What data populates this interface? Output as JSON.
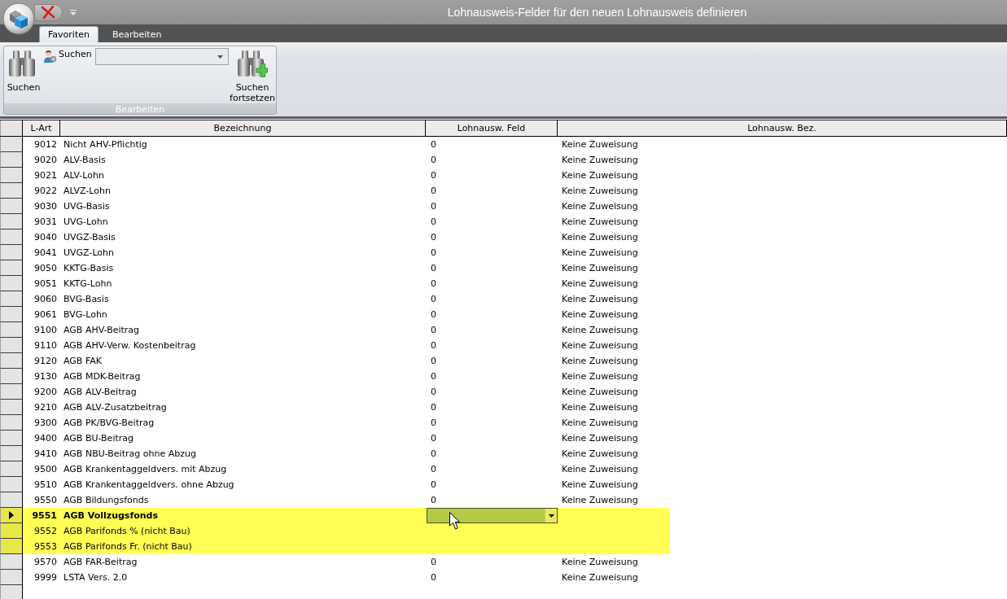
{
  "window": {
    "title": "Lohnausweis-Felder für den neuen Lohnausweis definieren"
  },
  "ribbon": {
    "tabs": [
      {
        "label": "Favoriten",
        "selected": true
      },
      {
        "label": "Bearbeiten",
        "selected": false
      }
    ],
    "groups": [
      {
        "label": "Bearbeiten",
        "items": [
          {
            "kind": "find",
            "label": "Suchen"
          },
          {
            "kind": "combo",
            "label": "Suchen"
          },
          {
            "kind": "find_next",
            "label": "Suchen fortsetzen"
          }
        ]
      }
    ]
  },
  "table": {
    "columns": [
      {
        "label": "L-Art"
      },
      {
        "label": "Bezeichnung"
      },
      {
        "label": "Lohnausw. Feld"
      },
      {
        "label": "Lohnausw. Bez."
      }
    ],
    "rows": [
      {
        "l_art": "9012",
        "bezeichnung": "Nicht AHV-Pflichtig",
        "lohnausw_feld": "0",
        "lohnausw_bez": "Keine Zuweisung",
        "selected": false,
        "current": false
      },
      {
        "l_art": "9020",
        "bezeichnung": "ALV-Basis",
        "lohnausw_feld": "0",
        "lohnausw_bez": "Keine Zuweisung",
        "selected": false,
        "current": false
      },
      {
        "l_art": "9021",
        "bezeichnung": "ALV-Lohn",
        "lohnausw_feld": "0",
        "lohnausw_bez": "Keine Zuweisung",
        "selected": false,
        "current": false
      },
      {
        "l_art": "9022",
        "bezeichnung": "ALVZ-Lohn",
        "lohnausw_feld": "0",
        "lohnausw_bez": "Keine Zuweisung",
        "selected": false,
        "current": false
      },
      {
        "l_art": "9030",
        "bezeichnung": "UVG-Basis",
        "lohnausw_feld": "0",
        "lohnausw_bez": "Keine Zuweisung",
        "selected": false,
        "current": false
      },
      {
        "l_art": "9031",
        "bezeichnung": "UVG-Lohn",
        "lohnausw_feld": "0",
        "lohnausw_bez": "Keine Zuweisung",
        "selected": false,
        "current": false
      },
      {
        "l_art": "9040",
        "bezeichnung": "UVGZ-Basis",
        "lohnausw_feld": "0",
        "lohnausw_bez": "Keine Zuweisung",
        "selected": false,
        "current": false
      },
      {
        "l_art": "9041",
        "bezeichnung": "UVGZ-Lohn",
        "lohnausw_feld": "0",
        "lohnausw_bez": "Keine Zuweisung",
        "selected": false,
        "current": false
      },
      {
        "l_art": "9050",
        "bezeichnung": "KKTG-Basis",
        "lohnausw_feld": "0",
        "lohnausw_bez": "Keine Zuweisung",
        "selected": false,
        "current": false
      },
      {
        "l_art": "9051",
        "bezeichnung": "KKTG-Lohn",
        "lohnausw_feld": "0",
        "lohnausw_bez": "Keine Zuweisung",
        "selected": false,
        "current": false
      },
      {
        "l_art": "9060",
        "bezeichnung": "BVG-Basis",
        "lohnausw_feld": "0",
        "lohnausw_bez": "Keine Zuweisung",
        "selected": false,
        "current": false
      },
      {
        "l_art": "9061",
        "bezeichnung": "BVG-Lohn",
        "lohnausw_feld": "0",
        "lohnausw_bez": "Keine Zuweisung",
        "selected": false,
        "current": false
      },
      {
        "l_art": "9100",
        "bezeichnung": "AGB AHV-Beitrag",
        "lohnausw_feld": "0",
        "lohnausw_bez": "Keine Zuweisung",
        "selected": false,
        "current": false
      },
      {
        "l_art": "9110",
        "bezeichnung": "AGB AHV-Verw. Kostenbeitrag",
        "lohnausw_feld": "0",
        "lohnausw_bez": "Keine Zuweisung",
        "selected": false,
        "current": false
      },
      {
        "l_art": "9120",
        "bezeichnung": "AGB FAK",
        "lohnausw_feld": "0",
        "lohnausw_bez": "Keine Zuweisung",
        "selected": false,
        "current": false
      },
      {
        "l_art": "9130",
        "bezeichnung": "AGB MDK-Beitrag",
        "lohnausw_feld": "0",
        "lohnausw_bez": "Keine Zuweisung",
        "selected": false,
        "current": false
      },
      {
        "l_art": "9200",
        "bezeichnung": "AGB ALV-Beitrag",
        "lohnausw_feld": "0",
        "lohnausw_bez": "Keine Zuweisung",
        "selected": false,
        "current": false
      },
      {
        "l_art": "9210",
        "bezeichnung": "AGB ALV-Zusatzbeitrag",
        "lohnausw_feld": "0",
        "lohnausw_bez": "Keine Zuweisung",
        "selected": false,
        "current": false
      },
      {
        "l_art": "9300",
        "bezeichnung": "AGB PK/BVG-Beitrag",
        "lohnausw_feld": "0",
        "lohnausw_bez": "Keine Zuweisung",
        "selected": false,
        "current": false
      },
      {
        "l_art": "9400",
        "bezeichnung": "AGB BU-Beitrag",
        "lohnausw_feld": "0",
        "lohnausw_bez": "Keine Zuweisung",
        "selected": false,
        "current": false
      },
      {
        "l_art": "9410",
        "bezeichnung": "AGB NBU-Beitrag ohne Abzug",
        "lohnausw_feld": "0",
        "lohnausw_bez": "Keine Zuweisung",
        "selected": false,
        "current": false
      },
      {
        "l_art": "9500",
        "bezeichnung": "AGB Krankentaggeldvers. mit Abzug",
        "lohnausw_feld": "0",
        "lohnausw_bez": "Keine Zuweisung",
        "selected": false,
        "current": false
      },
      {
        "l_art": "9510",
        "bezeichnung": "AGB Krankentaggeldvers. ohne Abzug",
        "lohnausw_feld": "0",
        "lohnausw_bez": "Keine Zuweisung",
        "selected": false,
        "current": false
      },
      {
        "l_art": "9550",
        "bezeichnung": "AGB Bildungsfonds",
        "lohnausw_feld": "0",
        "lohnausw_bez": "Keine Zuweisung",
        "selected": false,
        "current": false
      },
      {
        "l_art": "9551",
        "bezeichnung": "AGB Vollzugsfonds",
        "selected": true,
        "current": true
      },
      {
        "l_art": "9552",
        "bezeichnung": "AGB Parifonds % (nicht Bau)",
        "selected": true,
        "current": false
      },
      {
        "l_art": "9553",
        "bezeichnung": "AGB Parifonds Fr. (nicht Bau)",
        "selected": true,
        "current": false
      },
      {
        "l_art": "9570",
        "bezeichnung": "AGB FAR-Beitrag",
        "lohnausw_feld": "0",
        "lohnausw_bez": "Keine Zuweisung",
        "selected": false,
        "current": false
      },
      {
        "l_art": "9999",
        "bezeichnung": "LSTA Vers. 2.0",
        "lohnausw_feld": "0",
        "lohnausw_bez": "Keine Zuweisung",
        "selected": false,
        "current": false
      }
    ]
  }
}
